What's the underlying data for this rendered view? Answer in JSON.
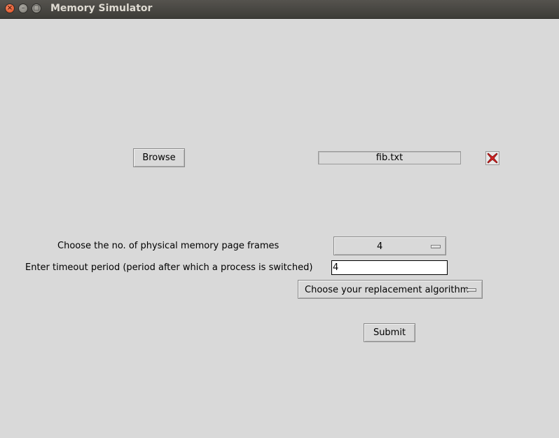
{
  "window": {
    "title": "Memory Simulator"
  },
  "file": {
    "browse_label": "Browse",
    "selected_file": "fib.txt"
  },
  "frames": {
    "label": "Choose the no. of physical memory page frames",
    "selected": "4"
  },
  "timeout": {
    "label": "Enter timeout period (period after which a process is switched)",
    "value": "4"
  },
  "algorithm": {
    "selected": "Choose your replacement algorithm"
  },
  "submit_label": "Submit",
  "colors": {
    "clear_icon": "#d42323",
    "titlebar": "#3d3c38",
    "window_bg": "#d9d9d9"
  }
}
